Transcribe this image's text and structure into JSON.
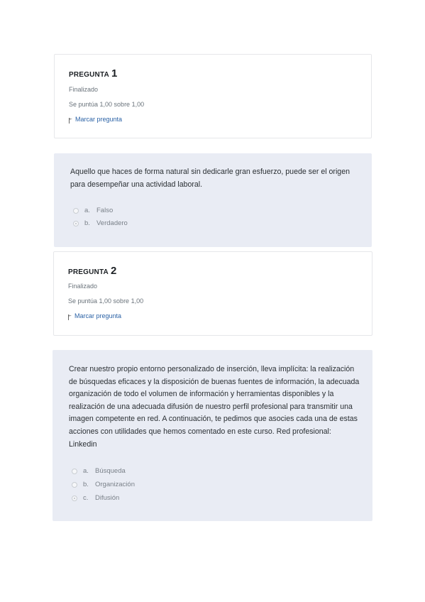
{
  "q1": {
    "label": "PREGUNTA",
    "number": "1",
    "status": "Finalizado",
    "score": "Se puntúa 1,00 sobre 1,00",
    "flag_label": "Marcar pregunta",
    "text": "Aquello que haces de forma natural sin dedicarle gran esfuerzo, puede ser el origen para desempeñar una actividad laboral.",
    "options": [
      {
        "letter": "a.",
        "label": "Falso",
        "selected": false
      },
      {
        "letter": "b.",
        "label": "Verdadero",
        "selected": true
      }
    ]
  },
  "q2": {
    "label": "PREGUNTA",
    "number": "2",
    "status": "Finalizado",
    "score": "Se puntúa 1,00 sobre 1,00",
    "flag_label": "Marcar pregunta",
    "text": "Crear nuestro propio entorno personalizado de inserción, lleva implícita: la realización de búsquedas eficaces y la disposición de buenas fuentes de información, la adecuada organización de todo el volumen de información y herramientas disponibles y la realización de una adecuada difusión de nuestro perfil profesional para transmitir una imagen competente en red. A continuación, te pedimos que asocies cada una de estas acciones con utilidades que hemos comentado en este curso. Red profesional: Linkedin",
    "options": [
      {
        "letter": "a.",
        "label": "Búsqueda",
        "selected": false
      },
      {
        "letter": "b.",
        "label": "Organización",
        "selected": false
      },
      {
        "letter": "c.",
        "label": "Difusión",
        "selected": true
      }
    ]
  },
  "colors": {
    "question_bg": "#e9ecf4",
    "link": "#2b62a6",
    "muted": "#6a737b"
  }
}
